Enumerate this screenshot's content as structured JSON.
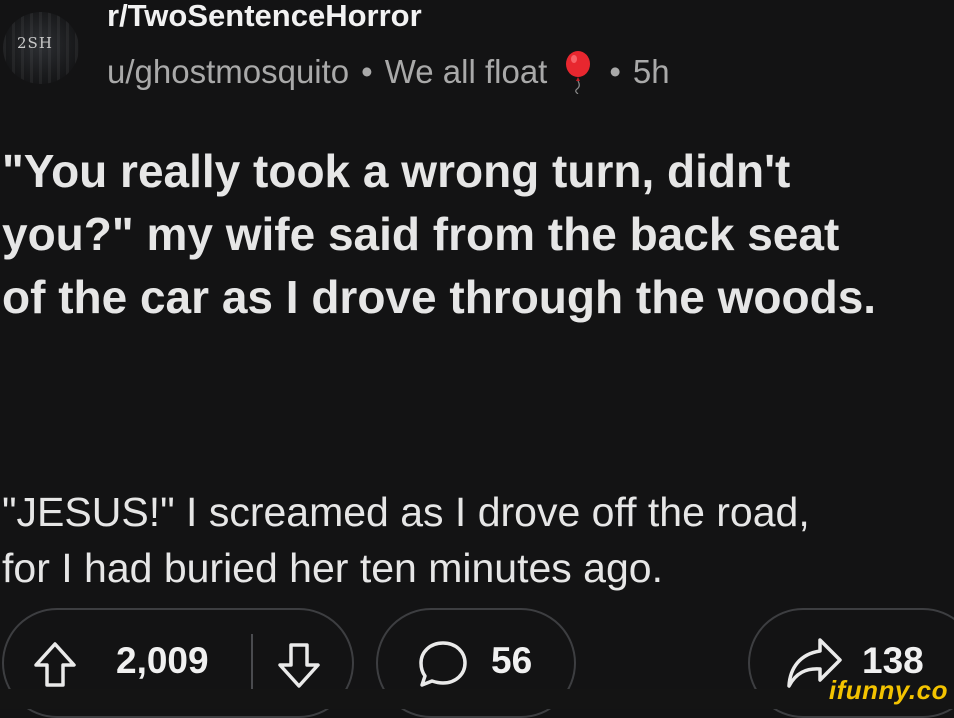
{
  "header": {
    "avatar_text": "2SH",
    "subreddit": "r/TwoSentenceHorror",
    "username": "u/ghostmosquito",
    "separator": "•",
    "flair": "We all float",
    "flair_icon": "red-balloon-icon",
    "age": "5h"
  },
  "post": {
    "title": "\"You really took a wrong turn, didn't\nyou?\" my wife said from the back seat\nof the car as I drove through the woods.",
    "body": "\"JESUS!\" I screamed as I drove off the road,\nfor I had buried her ten minutes ago."
  },
  "actions": {
    "upvote_icon": "upvote-arrow-icon",
    "score": "2,009",
    "downvote_icon": "downvote-arrow-icon",
    "comment_icon": "comment-bubble-icon",
    "comments": "56",
    "share_icon": "share-arrow-icon",
    "shares": "138"
  },
  "watermark": "ifunny.co",
  "colors": {
    "background": "#131314",
    "text": "#e6e6e6",
    "meta": "#a9a9a9",
    "pill_border": "#3d3e41",
    "balloon": "#e8272f",
    "watermark": "#f3c300"
  }
}
